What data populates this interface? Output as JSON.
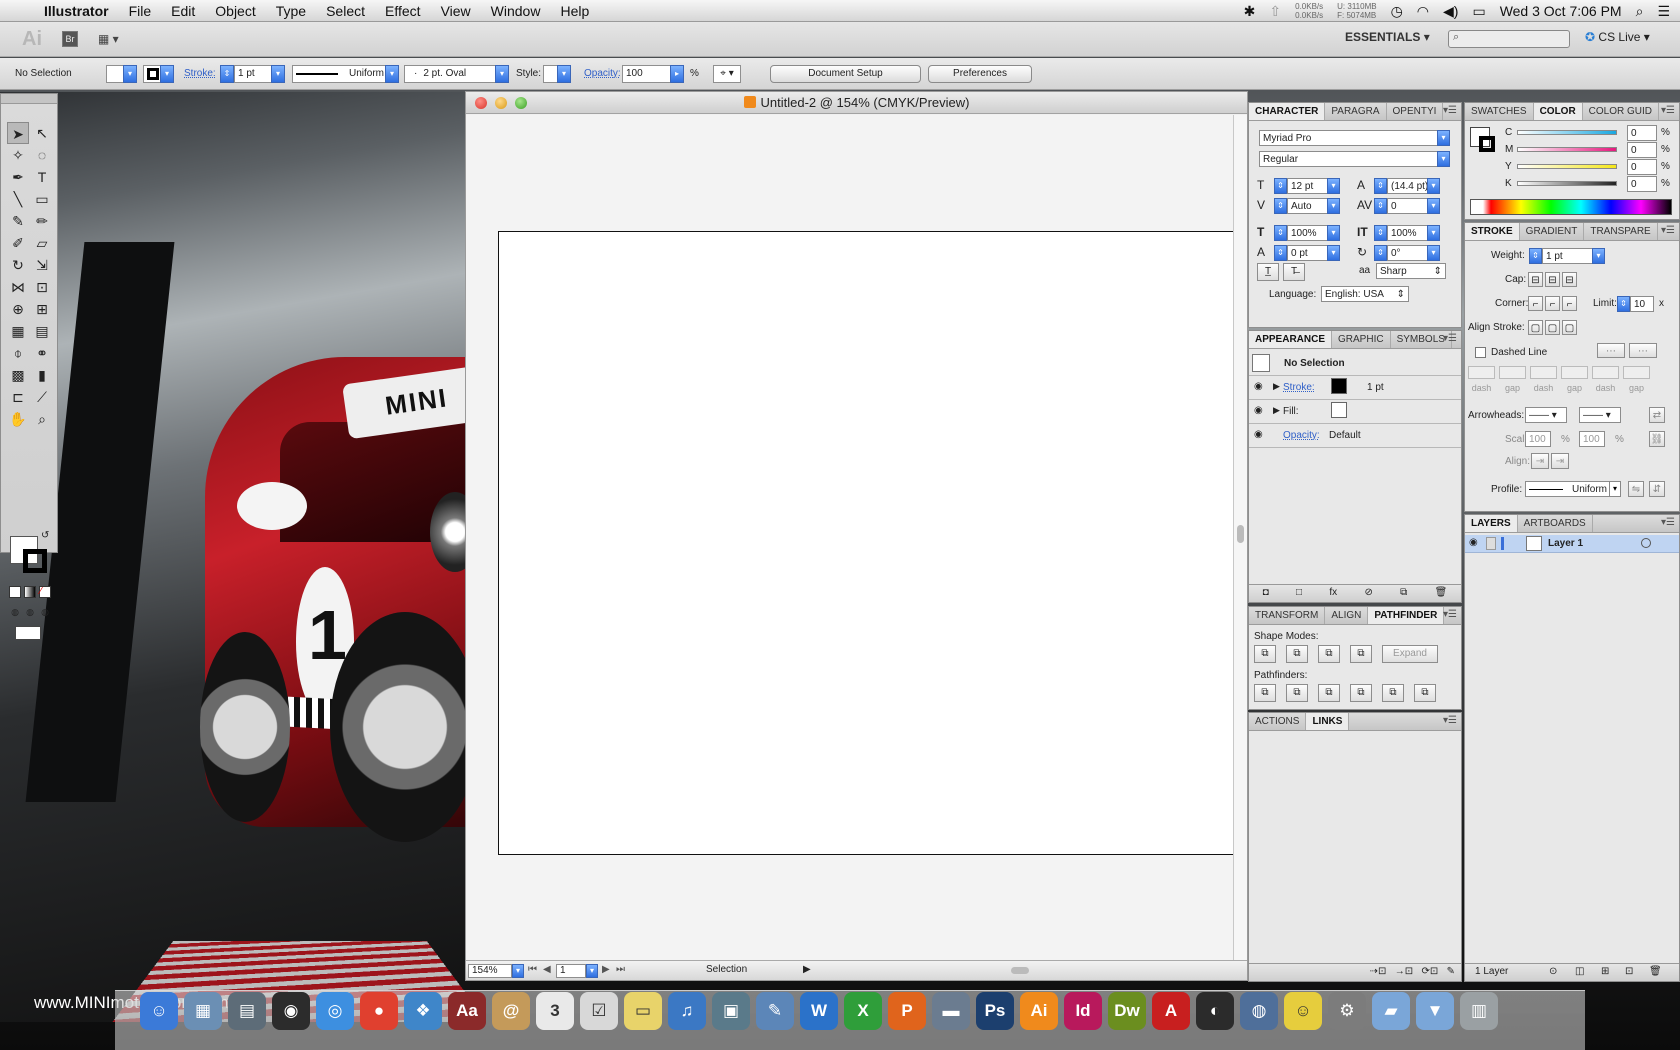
{
  "menubar": {
    "app_name": "Illustrator",
    "menus": [
      "File",
      "Edit",
      "Object",
      "Type",
      "Select",
      "Effect",
      "View",
      "Window",
      "Help"
    ],
    "net_up": "0.0KB/s",
    "net_down": "0.0KB/s",
    "mem_used": "U: 3110MB",
    "mem_free": "F: 5074MB",
    "clock": "Wed 3 Oct  7:06 PM"
  },
  "appbar": {
    "logo": "Ai",
    "bridge": "Br",
    "workspace": "ESSENTIALS",
    "cs_live": "CS Live"
  },
  "control": {
    "selection": "No Selection",
    "stroke_label": "Stroke:",
    "stroke_weight": "1 pt",
    "profile": "Uniform",
    "brush": "2 pt. Oval",
    "style_label": "Style:",
    "opacity_label": "Opacity:",
    "opacity_value": "100",
    "percent": "%",
    "doc_setup": "Document Setup",
    "preferences": "Preferences"
  },
  "document": {
    "title": "Untitled-2 @ 154% (CMYK/Preview)",
    "zoom": "154%",
    "artboard_number": "1",
    "status_tool": "Selection"
  },
  "character": {
    "tabs": [
      "CHARACTER",
      "PARAGRA",
      "OPENTYI"
    ],
    "font": "Myriad Pro",
    "style": "Regular",
    "size": "12 pt",
    "leading": "(14.4 pt)",
    "kerning": "Auto",
    "tracking": "0",
    "vscale": "100%",
    "hscale": "100%",
    "baseline": "0 pt",
    "rotation": "0°",
    "antialias_icon": "aa",
    "antialias": "Sharp",
    "language_label": "Language:",
    "language": "English: USA"
  },
  "appearance": {
    "tabs": [
      "APPEARANCE",
      "GRAPHIC",
      "SYMBOLS"
    ],
    "header": "No Selection",
    "stroke_label": "Stroke:",
    "stroke_value": "1 pt",
    "fill_label": "Fill:",
    "opacity_label": "Opacity:",
    "opacity_value": "Default"
  },
  "pathfinder": {
    "tabs": [
      "TRANSFORM",
      "ALIGN",
      "PATHFINDER"
    ],
    "shape_modes": "Shape Modes:",
    "expand": "Expand",
    "pathfinders": "Pathfinders:"
  },
  "actions": {
    "tabs": [
      "ACTIONS",
      "LINKS"
    ]
  },
  "color": {
    "tabs": [
      "SWATCHES",
      "COLOR",
      "COLOR GUID"
    ],
    "channels": [
      {
        "label": "C",
        "value": "0",
        "color": "#19a7e0"
      },
      {
        "label": "M",
        "value": "0",
        "color": "#e5197e"
      },
      {
        "label": "Y",
        "value": "0",
        "color": "#f4e61a"
      },
      {
        "label": "K",
        "value": "0",
        "color": "#222222"
      }
    ],
    "percent": "%"
  },
  "stroke_panel": {
    "tabs": [
      "STROKE",
      "GRADIENT",
      "TRANSPARE"
    ],
    "weight_label": "Weight:",
    "weight": "1 pt",
    "cap_label": "Cap:",
    "corner_label": "Corner:",
    "limit_label": "Limit:",
    "limit": "10",
    "limit_x": "x",
    "align_label": "Align Stroke:",
    "dashed": "Dashed Line",
    "dash_labels": [
      "dash",
      "gap",
      "dash",
      "gap",
      "dash",
      "gap"
    ],
    "arrowheads_label": "Arrowheads:",
    "scale_label": "Scale:",
    "scale1": "100",
    "scale2": "100",
    "align2_label": "Align:",
    "profile_label": "Profile:",
    "profile": "Uniform"
  },
  "layers": {
    "tabs": [
      "LAYERS",
      "ARTBOARDS"
    ],
    "layer_name": "Layer 1",
    "count": "1 Layer"
  },
  "wallpaper": {
    "text": "www.MINImotorsport.com"
  },
  "dock": {
    "apps": [
      {
        "name": "finder-icon",
        "glyph": "☺",
        "color": "#3b7ad8"
      },
      {
        "name": "preview-icon",
        "glyph": "▦",
        "color": "#6b8fb4"
      },
      {
        "name": "image-capture-icon",
        "glyph": "▤",
        "color": "#5d6c78"
      },
      {
        "name": "dashboard-icon",
        "glyph": "◉",
        "color": "#2c2c2c"
      },
      {
        "name": "safari-icon",
        "glyph": "◎",
        "color": "#3d8fe0"
      },
      {
        "name": "chrome-icon",
        "glyph": "●",
        "color": "#e0402f"
      },
      {
        "name": "ichat-icon",
        "glyph": "❖",
        "color": "#3f86c9"
      },
      {
        "name": "dictionary-icon",
        "glyph": "Aa",
        "color": "#8b2a2a"
      },
      {
        "name": "mail-icon",
        "glyph": "@",
        "color": "#c49a5a"
      },
      {
        "name": "ical-icon",
        "glyph": "3",
        "color": "#e9e9e9"
      },
      {
        "name": "reminders-icon",
        "glyph": "☑",
        "color": "#d8d8d8"
      },
      {
        "name": "stickies-icon",
        "glyph": "▭",
        "color": "#e8d36a"
      },
      {
        "name": "itunes-icon",
        "glyph": "♫",
        "color": "#3b78c4"
      },
      {
        "name": "iphoto-icon",
        "glyph": "▣",
        "color": "#5a7a8a"
      },
      {
        "name": "preview2-icon",
        "glyph": "✎",
        "color": "#5c86b8"
      },
      {
        "name": "word-icon",
        "glyph": "W",
        "color": "#2b72c9"
      },
      {
        "name": "excel-icon",
        "glyph": "X",
        "color": "#2f9e3a"
      },
      {
        "name": "powerpoint-icon",
        "glyph": "P",
        "color": "#e0641c"
      },
      {
        "name": "keynote-icon",
        "glyph": "▬",
        "color": "#6b7c90"
      },
      {
        "name": "photoshop-icon",
        "glyph": "Ps",
        "color": "#1c3f6e"
      },
      {
        "name": "illustrator-icon",
        "glyph": "Ai",
        "color": "#f08a1c"
      },
      {
        "name": "indesign-icon",
        "glyph": "Id",
        "color": "#b8195c"
      },
      {
        "name": "dreamweaver-icon",
        "glyph": "Dw",
        "color": "#6b8e1f"
      },
      {
        "name": "acrobat-icon",
        "glyph": "A",
        "color": "#c81f1f"
      },
      {
        "name": "steam-icon",
        "glyph": "◐",
        "color": "#2b2b2b"
      },
      {
        "name": "photo-booth-icon",
        "glyph": "◍",
        "color": "#4f6f9a"
      },
      {
        "name": "notes-icon",
        "glyph": "☺",
        "color": "#e6cd3d"
      },
      {
        "name": "system-preferences-icon",
        "glyph": "⚙",
        "color": "#7c7c7c"
      },
      {
        "name": "folder-icon",
        "glyph": "▰",
        "color": "#7aa6d8"
      },
      {
        "name": "downloads-icon",
        "glyph": "▼",
        "color": "#7aa6d8"
      },
      {
        "name": "trash-icon",
        "glyph": "▥",
        "color": "#9aa0a3"
      }
    ]
  }
}
